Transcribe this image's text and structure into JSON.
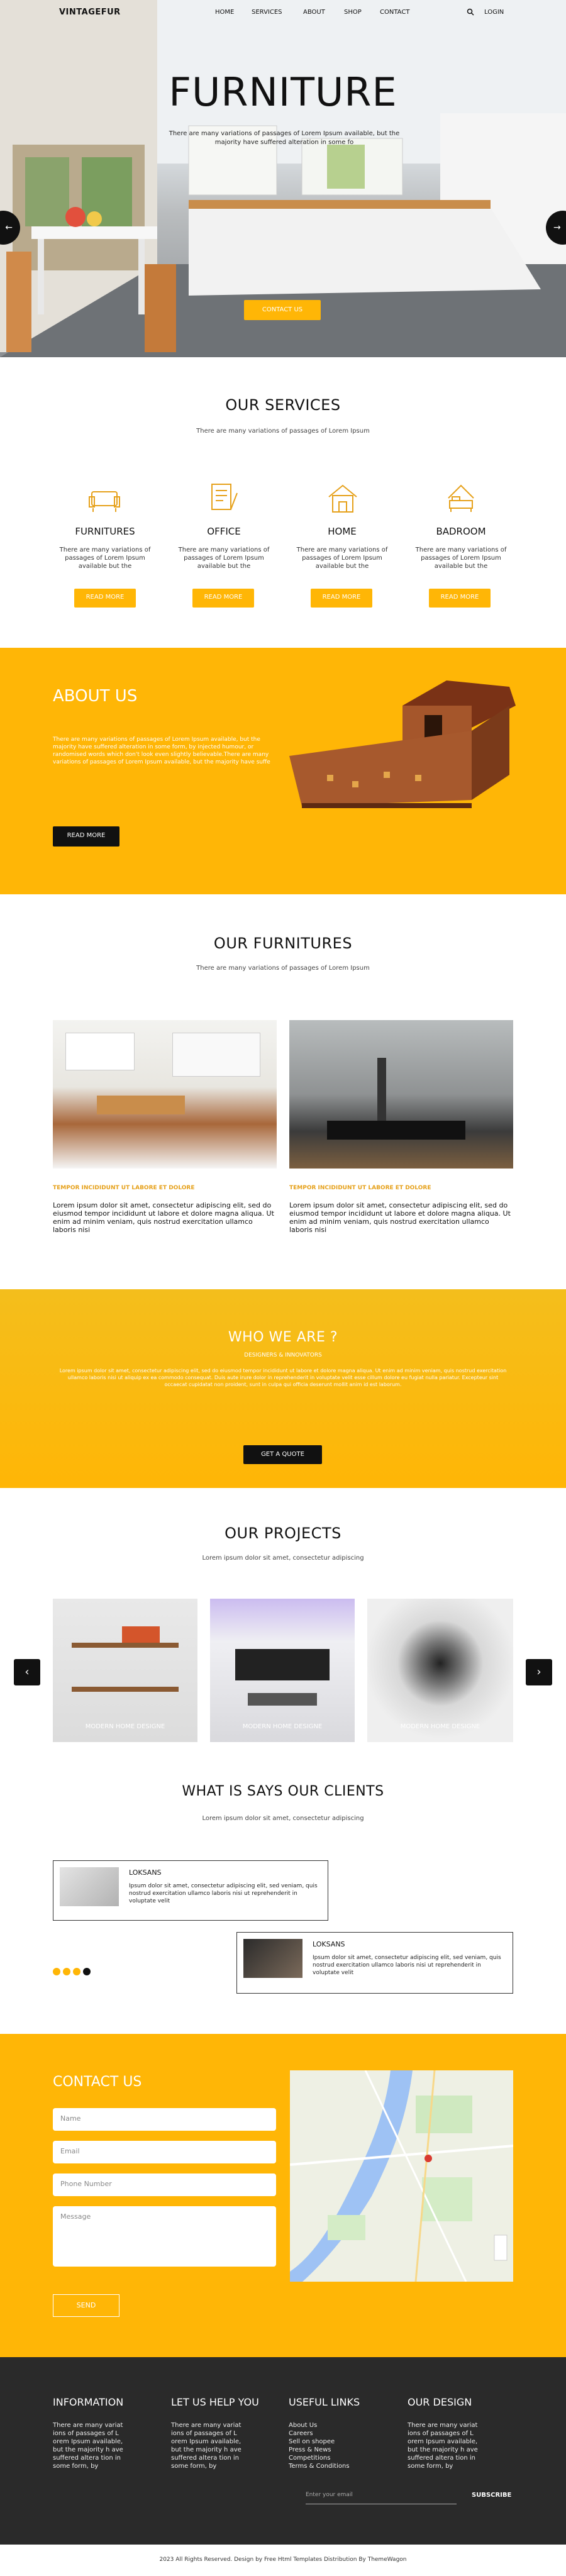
{
  "nav": {
    "logo": "VINTAGEFUR",
    "items": [
      "HOME",
      "SERVICES",
      "ABOUT",
      "SHOP",
      "CONTACT"
    ],
    "login": "LOGIN"
  },
  "hero": {
    "title": "FURNITURE",
    "text": "There are many variations of passages of Lorem Ipsum available, but the majority have suffered alteration in some fo",
    "button": "CONTACT US",
    "prev": "←",
    "next": "→"
  },
  "services": {
    "title": "OUR SERVICES",
    "subtitle": "There are many variations of passages of Lorem Ipsum",
    "items": [
      {
        "title": "FURNITURES",
        "text": "There are many variations of passages of Lorem Ipsum available but the",
        "button": "READ MORE"
      },
      {
        "title": "OFFICE",
        "text": "There are many variations of passages of Lorem Ipsum available but the",
        "button": "READ MORE"
      },
      {
        "title": "HOME",
        "text": "There are many variations of passages of Lorem Ipsum available but the",
        "button": "READ MORE"
      },
      {
        "title": "BADROOM",
        "text": "There are many variations of passages of Lorem Ipsum available but the",
        "button": "READ MORE"
      }
    ]
  },
  "about": {
    "title": "ABOUT US",
    "text": "There are many variations of passages of Lorem Ipsum available, but the majority have suffered alteration in some form, by injected humour, or randomised words which don't look even slightly believable.There are many variations of passages of Lorem Ipsum available, but the majority have suffe",
    "button": "READ MORE"
  },
  "furnitures": {
    "title": "OUR FURNITURES",
    "subtitle": "There are many variations of passages of Lorem Ipsum",
    "items": [
      {
        "caption": "TEMPOR INCIDIDUNT UT LABORE ET DOLORE",
        "text": "Lorem ipsum dolor sit amet, consectetur adipiscing elit, sed do eiusmod tempor incididunt ut labore et dolore magna aliqua. Ut enim ad minim veniam, quis nostrud exercitation ullamco laboris nisi"
      },
      {
        "caption": "TEMPOR INCIDIDUNT UT LABORE ET DOLORE",
        "text": "Lorem ipsum dolor sit amet, consectetur adipiscing elit, sed do eiusmod tempor incididunt ut labore et dolore magna aliqua. Ut enim ad minim veniam, quis nostrud exercitation ullamco laboris nisi"
      }
    ]
  },
  "who": {
    "title": "WHO WE ARE ?",
    "subtitle": "DESIGNERS & INNOVATORS",
    "text": "Lorem ipsum dolor sit amet, consectetur adipiscing elit, sed do eiusmod tempor incididunt ut labore et dolore magna aliqua. Ut enim ad minim veniam, quis nostrud exercitation ullamco laboris nisi ut aliquip ex ea commodo consequat. Duis aute irure dolor in reprehenderit in voluptate velit esse cillum dolore eu fugiat nulla pariatur. Excepteur sint occaecat cupidatat non proident, sunt in culpa qui officia deserunt mollit anim id est laborum.",
    "button": "GET A QUOTE"
  },
  "projects": {
    "title": "OUR PROJECTS",
    "subtitle": "Lorem ipsum dolor sit amet, consectetur adipiscing",
    "items": [
      "MODERN HOME DESIGNE",
      "MODERN HOME DESIGNE",
      "MODERN HOME DESIGNE"
    ],
    "prev": "‹",
    "next": "›"
  },
  "clients": {
    "title": "WHAT IS SAYS OUR CLIENTS",
    "subtitle": "Lorem ipsum dolor sit amet, consectetur adipiscing",
    "items": [
      {
        "name": "LOKSANS",
        "text": "Ipsum dolor sit amet, consectetur adipiscing elit, sed veniam, quis nostrud exercitation ullamco laboris nisi ut reprehenderit in voluptate velit"
      },
      {
        "name": "LOKSANS",
        "text": "Ipsum dolor sit amet, consectetur adipiscing elit, sed veniam, quis nostrud exercitation ullamco laboris nisi ut reprehenderit in voluptate velit"
      }
    ]
  },
  "contact": {
    "title": "CONTACT US",
    "name": "Name",
    "email": "Email",
    "phone": "Phone Number",
    "message": "Message",
    "send": "SEND"
  },
  "footer": {
    "cols": [
      {
        "title": "INFORMATION",
        "text": "There are many variat ions of passages of L orem Ipsum available, but the majority h ave suffered altera tion in some form, by"
      },
      {
        "title": "LET US HELP YOU",
        "text": "There are many variat ions of passages of L orem Ipsum available, but the majority h ave suffered altera tion in some form, by"
      },
      {
        "title": "USEFUL LINKS",
        "links": [
          "About Us",
          "Careers",
          "Sell on shopee",
          "Press & News",
          "Competitions",
          "Terms & Conditions"
        ]
      },
      {
        "title": "OUR DESIGN",
        "text": "There are many variat ions of passages of L orem Ipsum available, but the majority h ave suffered altera tion in some form, by"
      }
    ],
    "email_placeholder": "Enter your email",
    "subscribe": "SUBSCRIBE",
    "copyright": "2023 All Rights Reserved. Design by Free Html Templates Distribution By ThemeWagon"
  },
  "colors": {
    "accent": "#ffb606",
    "dark": "#222222",
    "footer": "#2a2a2a"
  }
}
